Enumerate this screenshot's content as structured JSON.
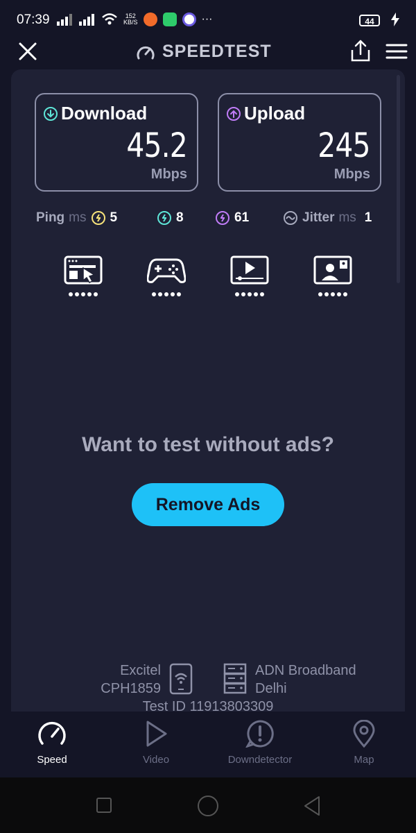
{
  "status_bar": {
    "time": "07:39",
    "net_speed_value": "152",
    "net_speed_unit": "KB/S",
    "more": "···",
    "battery": "44"
  },
  "header": {
    "brand": "SPEEDTEST"
  },
  "results": {
    "download": {
      "label": "Download",
      "value": "45.2",
      "unit": "Mbps",
      "accent": "#5ee6d8"
    },
    "upload": {
      "label": "Upload",
      "value": "245",
      "unit": "Mbps",
      "accent": "#c07cf7"
    }
  },
  "metrics": {
    "ping_label": "Ping",
    "ping_unit": "ms",
    "ping_idle": "5",
    "ping_download": "8",
    "ping_upload": "61",
    "jitter_label": "Jitter",
    "jitter_unit": "ms",
    "jitter_value": "1",
    "colors": {
      "idle": "#f6e27a",
      "download": "#5ee6d8",
      "upload": "#c07cf7"
    }
  },
  "activities": [
    {
      "icon": "web-browsing-icon",
      "rating": 5
    },
    {
      "icon": "gaming-icon",
      "rating": 5
    },
    {
      "icon": "video-streaming-icon",
      "rating": 5
    },
    {
      "icon": "video-chat-icon",
      "rating": 5
    }
  ],
  "promo": {
    "text": "Want to test without ads?",
    "button": "Remove Ads",
    "button_color": "#1ec1f7"
  },
  "connection": {
    "client_isp": "Excitel",
    "client_device": "CPH1859",
    "server_name": "ADN Broadband",
    "server_location": "Delhi",
    "test_id": "Test ID 11913803309"
  },
  "bottom_nav": [
    {
      "label": "Speed",
      "icon": "speedometer-icon",
      "active": true
    },
    {
      "label": "Video",
      "icon": "play-icon",
      "active": false
    },
    {
      "label": "Downdetector",
      "icon": "alert-icon",
      "active": false
    },
    {
      "label": "Map",
      "icon": "map-pin-icon",
      "active": false
    }
  ]
}
